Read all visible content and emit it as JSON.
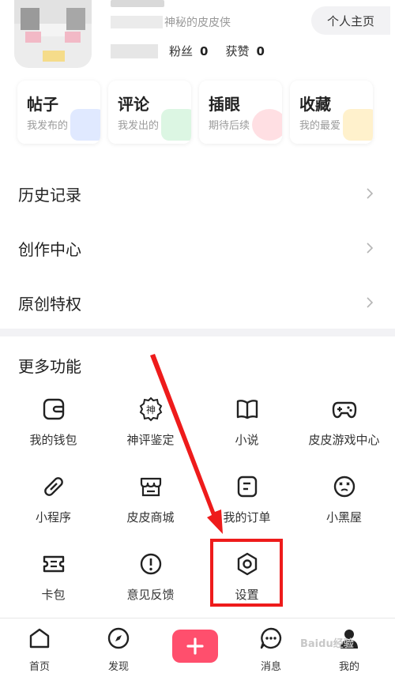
{
  "profile": {
    "motto": "神秘的皮皮侠",
    "fans_label": "粉丝",
    "fans_count": "0",
    "likes_label": "获赞",
    "likes_count": "0",
    "home_button": "个人主页"
  },
  "quick_cards": [
    {
      "title": "帖子",
      "subtitle": "我发布的"
    },
    {
      "title": "评论",
      "subtitle": "我发出的"
    },
    {
      "title": "插眼",
      "subtitle": "期待后续"
    },
    {
      "title": "收藏",
      "subtitle": "我的最爱"
    }
  ],
  "menu": {
    "history": "历史记录",
    "creation": "创作中心",
    "original": "原创特权"
  },
  "more": {
    "title": "更多功能",
    "items": [
      {
        "label": "我的钱包",
        "icon": "wallet-icon"
      },
      {
        "label": "神评鉴定",
        "icon": "shen-badge-icon"
      },
      {
        "label": "小说",
        "icon": "book-icon"
      },
      {
        "label": "皮皮游戏中心",
        "icon": "gamepad-icon"
      },
      {
        "label": "小程序",
        "icon": "link-icon"
      },
      {
        "label": "皮皮商城",
        "icon": "store-icon"
      },
      {
        "label": "我的订单",
        "icon": "order-icon"
      },
      {
        "label": "小黑屋",
        "icon": "face-icon"
      },
      {
        "label": "卡包",
        "icon": "ticket-icon"
      },
      {
        "label": "意见反馈",
        "icon": "feedback-icon"
      },
      {
        "label": "设置",
        "icon": "gear-icon"
      }
    ],
    "shen_glyph": "神"
  },
  "tabbar": {
    "home": "首页",
    "discover": "发现",
    "messages": "消息",
    "me": "我的"
  },
  "watermark": "Baidu经验",
  "colors": {
    "accent": "#ff4f6d",
    "annotation": "#ee1b1b"
  }
}
